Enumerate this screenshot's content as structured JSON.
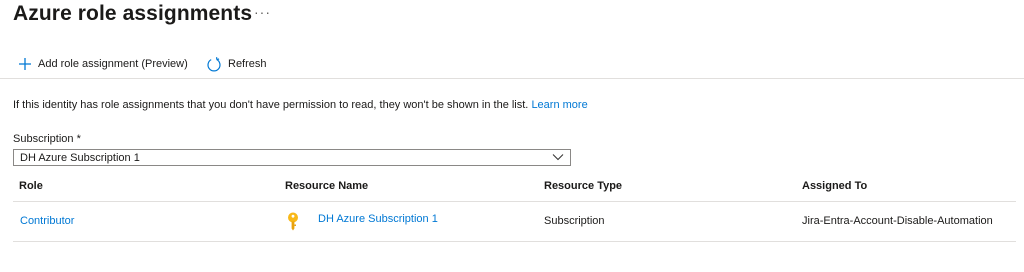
{
  "header": {
    "title": "Azure role assignments",
    "more": "···"
  },
  "toolbar": {
    "add_label": "Add role assignment (Preview)",
    "refresh_label": "Refresh"
  },
  "info": {
    "text": "If this identity has role assignments that you don't have permission to read, they won't be shown in the list.",
    "link": "Learn more"
  },
  "subscription": {
    "label": "Subscription *",
    "value": "DH Azure Subscription 1"
  },
  "table": {
    "columns": [
      "Role",
      "Resource Name",
      "Resource Type",
      "Assigned To"
    ],
    "rows": [
      {
        "role": "Contributor",
        "resource_name": "DH Azure Subscription 1",
        "resource_type": "Subscription",
        "assigned_to": "Jira-Entra-Account-Disable-Automation"
      }
    ]
  },
  "colors": {
    "accent": "#0078d4",
    "key_icon": "#f8b818",
    "divider": "#e1dfdd"
  },
  "icons": [
    "add-icon",
    "refresh-icon",
    "chevron-down-icon",
    "key-icon"
  ]
}
